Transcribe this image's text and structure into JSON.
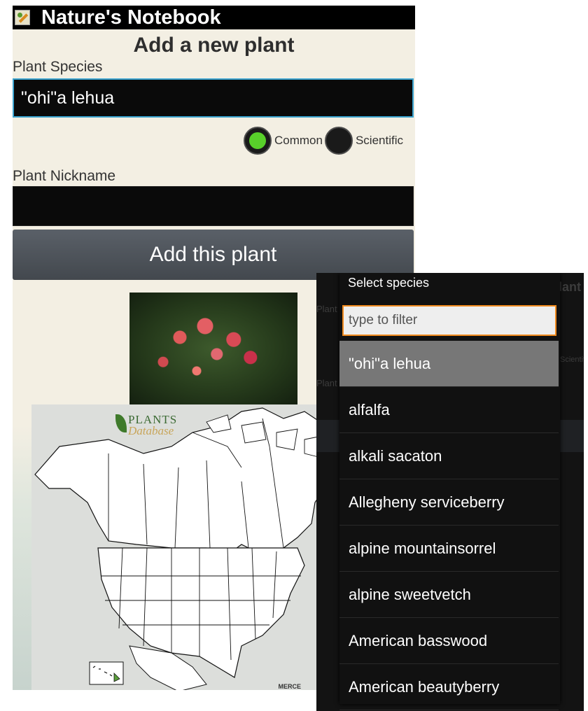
{
  "app": {
    "title": "Nature's Notebook"
  },
  "form": {
    "heading": "Add a new plant",
    "species_label": "Plant Species",
    "species_value": "\"ohi\"a lehua",
    "radio_common": "Common",
    "radio_scientific": "Scientific",
    "nickname_label": "Plant Nickname",
    "nickname_value": "",
    "add_button": "Add this plant"
  },
  "map": {
    "logo_line1": "PLANTS",
    "logo_line2": "Database",
    "footer": "MERCE"
  },
  "dialog": {
    "title": "Select species",
    "filter_placeholder": "type to filter",
    "items": [
      "\"ohi\"a lehua",
      "alfalfa",
      "alkali sacaton",
      "Allegheny serviceberry",
      "alpine mountainsorrel",
      "alpine sweetvetch",
      "American basswood",
      "American beautyberry"
    ]
  },
  "colors": {
    "accent_focus": "#3aa3cf",
    "radio_selected": "#58d02a",
    "filter_border": "#f08a1e",
    "selected_row": "#777777"
  }
}
